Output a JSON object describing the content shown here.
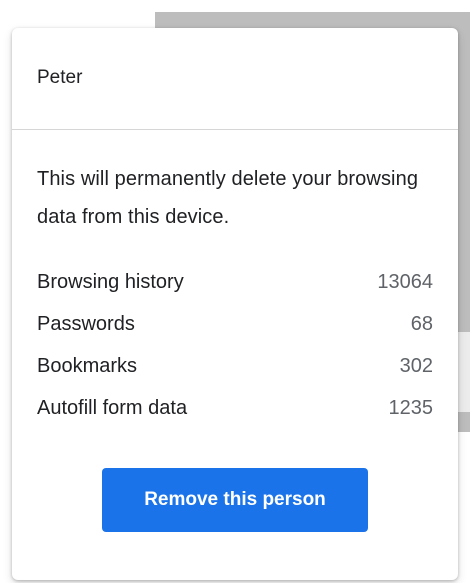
{
  "dialog": {
    "profile_name": "Peter",
    "warning": "This will permanently delete your browsing data from this device.",
    "stats": [
      {
        "label": "Browsing history",
        "value": "13064"
      },
      {
        "label": "Passwords",
        "value": "68"
      },
      {
        "label": "Bookmarks",
        "value": "302"
      },
      {
        "label": "Autofill form data",
        "value": "1235"
      }
    ],
    "remove_button_label": "Remove this person"
  },
  "colors": {
    "accent": "#1a73e8",
    "background_window": "#bdbdbd"
  }
}
